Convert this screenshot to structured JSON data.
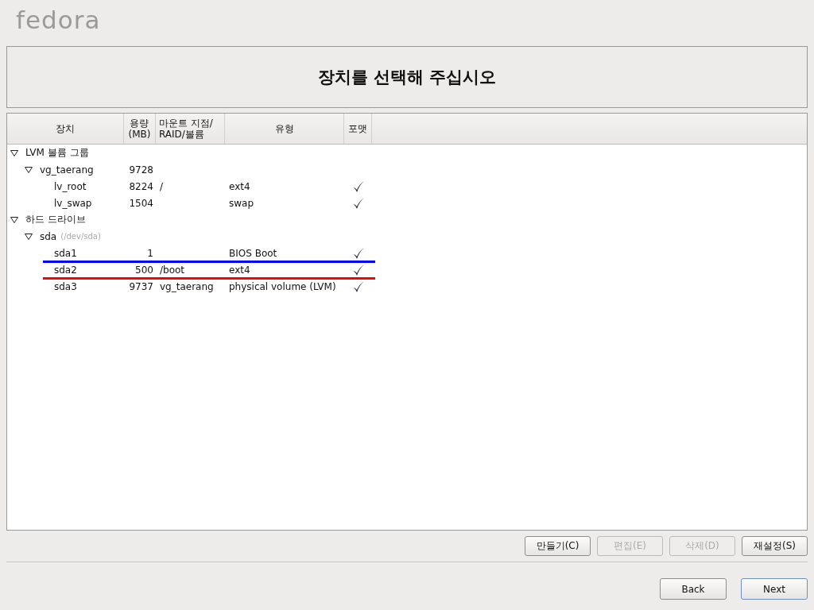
{
  "logo": "fedora",
  "title": "장치를 선택해 주십시오",
  "table": {
    "columns": [
      "장치",
      "용량\n(MB)",
      "마운트 지점/\nRAID/볼륨",
      "유형",
      "포맷"
    ],
    "rows": [
      {
        "name": "LVM 볼륨 그룹",
        "expanded": true,
        "children": [
          {
            "name": "vg_taerang",
            "size": "9728",
            "expanded": true,
            "children": [
              {
                "name": "lv_root",
                "size": "8224",
                "mount": "/",
                "type": "ext4",
                "format": true
              },
              {
                "name": "lv_swap",
                "size": "1504",
                "type": "swap",
                "format": true
              }
            ]
          }
        ]
      },
      {
        "name": "하드 드라이브",
        "expanded": true,
        "children": [
          {
            "name": "sda",
            "note": "(/dev/sda)",
            "expanded": true,
            "children": [
              {
                "name": "sda1",
                "size": "1",
                "type": "BIOS Boot",
                "format": true,
                "color": "#0000ff"
              },
              {
                "name": "sda2",
                "size": "500",
                "mount": "/boot",
                "type": "ext4",
                "format": true,
                "color": "#ff0000"
              },
              {
                "name": "sda3",
                "size": "9737",
                "mount": "vg_taerang",
                "type": "physical volume (LVM)",
                "format": true
              }
            ]
          }
        ]
      }
    ]
  },
  "actions": [
    {
      "label": "만들기(C)",
      "disabled": false
    },
    {
      "label": "편집(E)",
      "disabled": true
    },
    {
      "label": "삭제(D)",
      "disabled": true
    },
    {
      "label": "재설정(S)",
      "disabled": false
    }
  ],
  "nav": [
    {
      "label": "Back",
      "selected": false
    },
    {
      "label": "Next",
      "selected": true
    }
  ]
}
